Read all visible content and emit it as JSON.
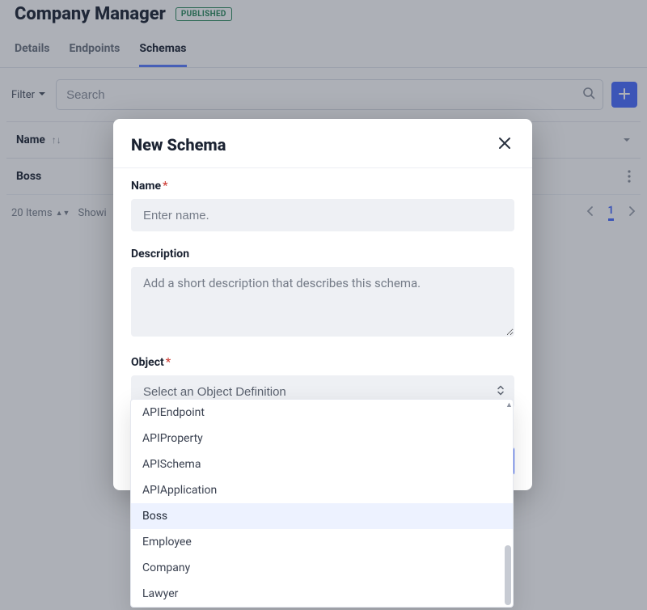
{
  "header": {
    "title": "Company Manager",
    "status": "PUBLISHED"
  },
  "tabs": [
    {
      "label": "Details",
      "active": false
    },
    {
      "label": "Endpoints",
      "active": false
    },
    {
      "label": "Schemas",
      "active": true
    }
  ],
  "toolbar": {
    "filter_label": "Filter",
    "search_placeholder": "Search"
  },
  "table": {
    "header_name": "Name",
    "rows": [
      {
        "name": "Boss"
      }
    ]
  },
  "pagination": {
    "items_count": "20 Items",
    "showing_prefix": "Showi",
    "current_page": "1"
  },
  "modal": {
    "title": "New Schema",
    "fields": {
      "name_label": "Name",
      "name_placeholder": "Enter name.",
      "description_label": "Description",
      "description_placeholder": "Add a short description that describes this schema.",
      "object_label": "Object",
      "object_placeholder": "Select an Object Definition"
    },
    "object_options": [
      {
        "label": "APIEndpoint",
        "highlight": false
      },
      {
        "label": "APIProperty",
        "highlight": false
      },
      {
        "label": "APISchema",
        "highlight": false
      },
      {
        "label": "APIApplication",
        "highlight": false
      },
      {
        "label": "Boss",
        "highlight": true
      },
      {
        "label": "Employee",
        "highlight": false
      },
      {
        "label": "Company",
        "highlight": false
      },
      {
        "label": "Lawyer",
        "highlight": false
      }
    ]
  }
}
